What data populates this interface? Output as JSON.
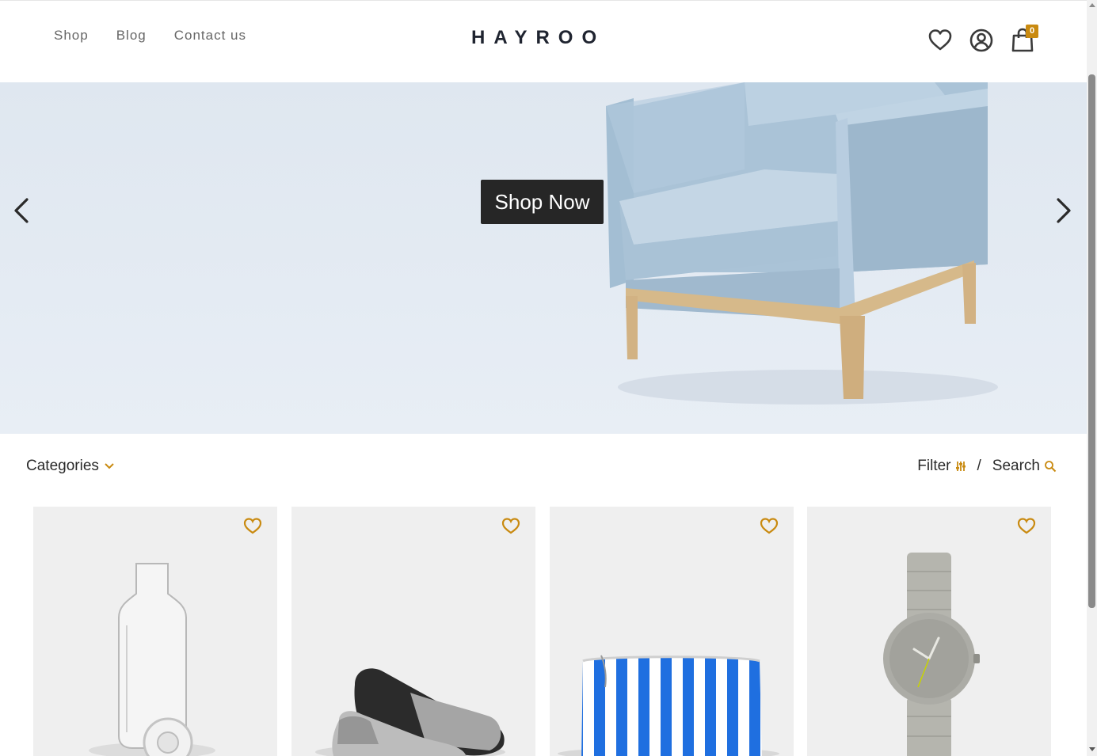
{
  "header": {
    "nav": [
      "Shop",
      "Blog",
      "Contact us"
    ],
    "logo": "HAYROO",
    "cart_count": "0",
    "icons": [
      "heart-icon",
      "user-icon",
      "bag-icon"
    ]
  },
  "hero": {
    "cta": "Shop Now",
    "prev_icon": "chevron-left-icon",
    "next_icon": "chevron-right-icon"
  },
  "toolbar": {
    "categories": "Categories",
    "filter": "Filter",
    "separator": "/",
    "search": "Search"
  },
  "products": [
    {
      "image": "glass-bottle"
    },
    {
      "image": "slippers"
    },
    {
      "image": "striped-pouch"
    },
    {
      "image": "wristwatch"
    }
  ],
  "colors": {
    "accent": "#c98a10",
    "dark_button": "#262626",
    "hero_bg": "#e2e9f2",
    "card_bg": "#efefef"
  }
}
